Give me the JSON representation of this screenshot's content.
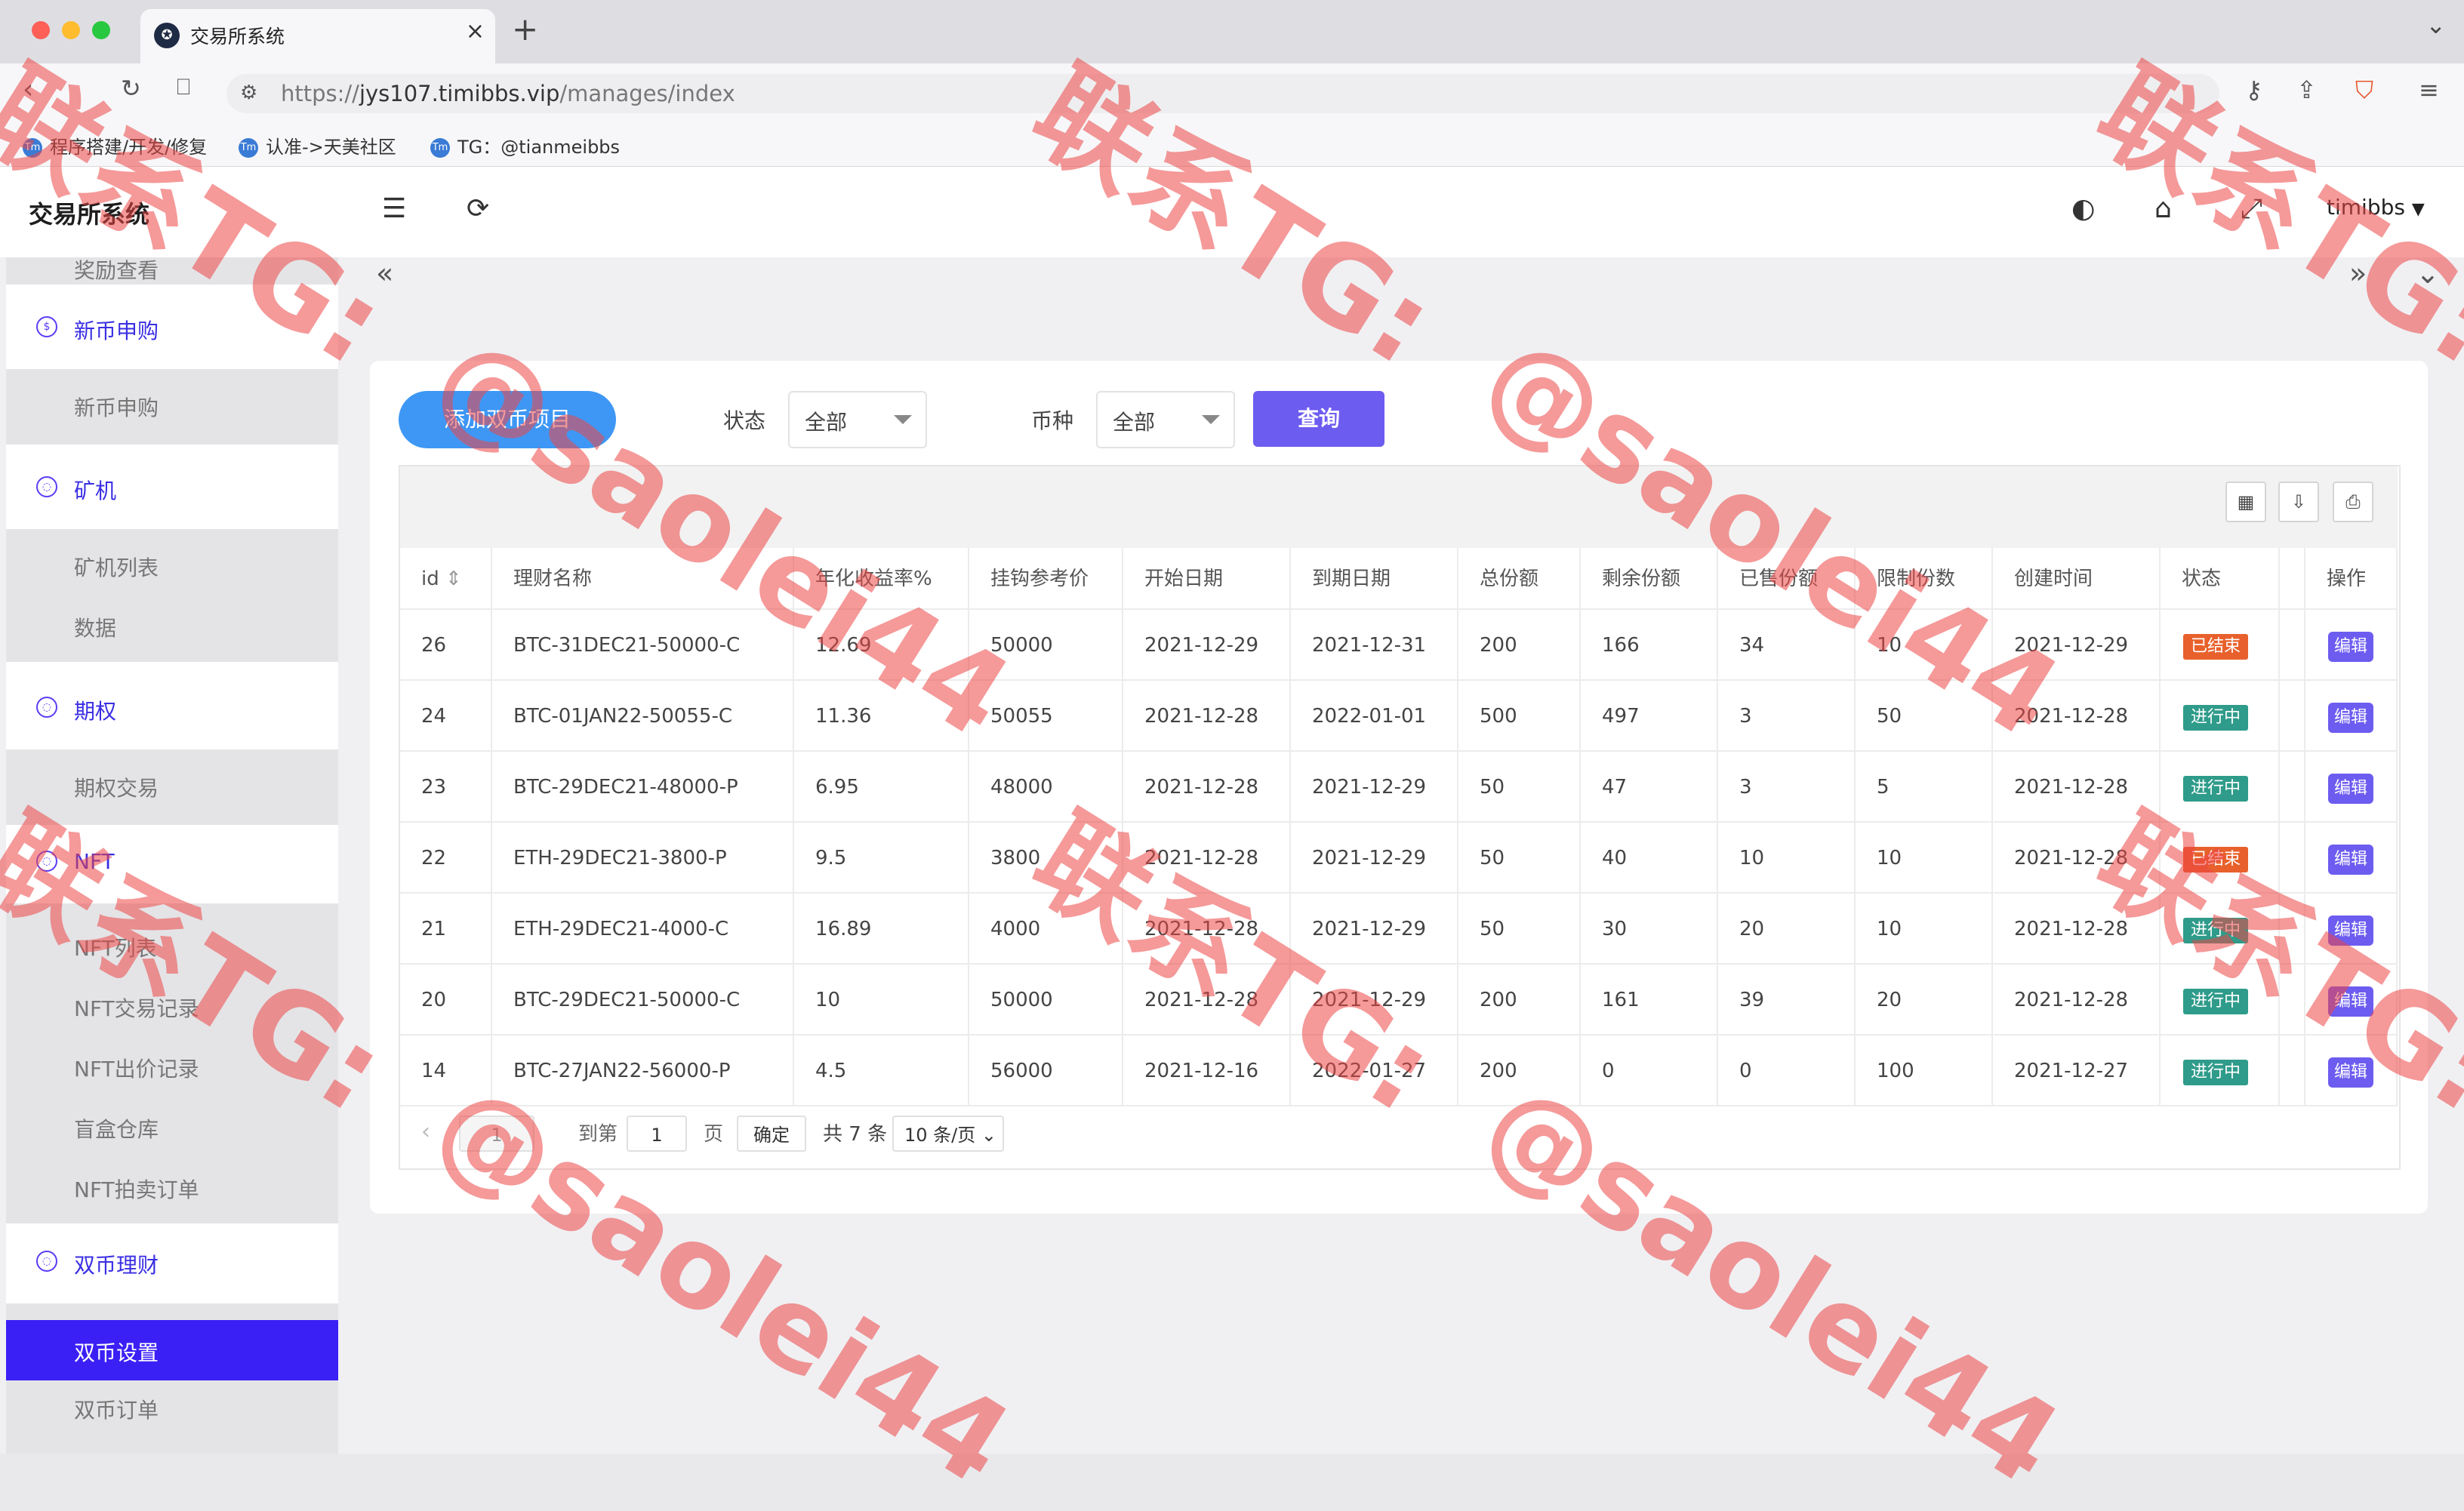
{
  "browser": {
    "tab_title": "交易所系统",
    "url_prefix": "https://",
    "url_host": "jys107.timibbs.vip",
    "url_path": "/manages/index",
    "bookmarks": [
      "程序搭建/开发/修复",
      "认准->天美社区",
      "TG：@tianmeibbs"
    ]
  },
  "app": {
    "brand": "交易所系统",
    "user": "timibbs"
  },
  "sidebar": {
    "top_partial": "奖励查看",
    "groups": [
      {
        "label": "新币申购",
        "icon": "coin-icon",
        "items": [
          "新币申购"
        ]
      },
      {
        "label": "矿机",
        "icon": "circle-icon",
        "items": [
          "矿机列表",
          "数据"
        ]
      },
      {
        "label": "期权",
        "icon": "circle-icon",
        "items": [
          "期权交易"
        ]
      },
      {
        "label": "NFT",
        "icon": "circle-icon",
        "items": [
          "NFT列表",
          "NFT交易记录",
          "NFT出价记录",
          "盲盒仓库",
          "NFT拍卖订单"
        ]
      },
      {
        "label": "双币理财",
        "icon": "circle-icon",
        "items": [
          "双币设置",
          "双币订单"
        ]
      }
    ],
    "active_item": "双币设置"
  },
  "toolbar": {
    "add_button": "添加双币项目",
    "status_label": "状态",
    "status_value": "全部",
    "coin_label": "币种",
    "coin_value": "全部",
    "query_button": "查询"
  },
  "table": {
    "headers": [
      "id",
      "理财名称",
      "年化收益率%",
      "挂钩参考价",
      "开始日期",
      "到期日期",
      "总份额",
      "剩余份额",
      "已售份额",
      "限制份数",
      "创建时间",
      "状态",
      "",
      "操作"
    ],
    "rows": [
      [
        "26",
        "BTC-31DEC21-50000-C",
        "12.69",
        "50000",
        "2021-12-29",
        "2021-12-31",
        "200",
        "166",
        "34",
        "10",
        "2021-12-29",
        "已结束",
        "编辑"
      ],
      [
        "24",
        "BTC-01JAN22-50055-C",
        "11.36",
        "50055",
        "2021-12-28",
        "2022-01-01",
        "500",
        "497",
        "3",
        "50",
        "2021-12-28",
        "进行中",
        "编辑"
      ],
      [
        "23",
        "BTC-29DEC21-48000-P",
        "6.95",
        "48000",
        "2021-12-28",
        "2021-12-29",
        "50",
        "47",
        "3",
        "5",
        "2021-12-28",
        "进行中",
        "编辑"
      ],
      [
        "22",
        "ETH-29DEC21-3800-P",
        "9.5",
        "3800",
        "2021-12-28",
        "2021-12-29",
        "50",
        "40",
        "10",
        "10",
        "2021-12-28",
        "已结束",
        "编辑"
      ],
      [
        "21",
        "ETH-29DEC21-4000-C",
        "16.89",
        "4000",
        "2021-12-28",
        "2021-12-29",
        "50",
        "30",
        "20",
        "10",
        "2021-12-28",
        "进行中",
        "编辑"
      ],
      [
        "20",
        "BTC-29DEC21-50000-C",
        "10",
        "50000",
        "2021-12-28",
        "2021-12-29",
        "200",
        "161",
        "39",
        "20",
        "2021-12-28",
        "进行中",
        "编辑"
      ],
      [
        "14",
        "BTC-27JAN22-56000-P",
        "4.5",
        "56000",
        "2021-12-16",
        "2022-01-27",
        "200",
        "0",
        "0",
        "100",
        "2021-12-27",
        "进行中",
        "编辑"
      ]
    ],
    "status_colors": {
      "已结束": "#e8612c",
      "进行中": "#2f9b8a"
    }
  },
  "pager": {
    "current": "1",
    "goto_label": "到第",
    "goto_value": "1",
    "page_unit": "页",
    "confirm": "确定",
    "total": "共 7 条",
    "page_size": "10 条/页"
  },
  "watermark": {
    "line1": "联系TG:",
    "line2": "@saolei44"
  }
}
